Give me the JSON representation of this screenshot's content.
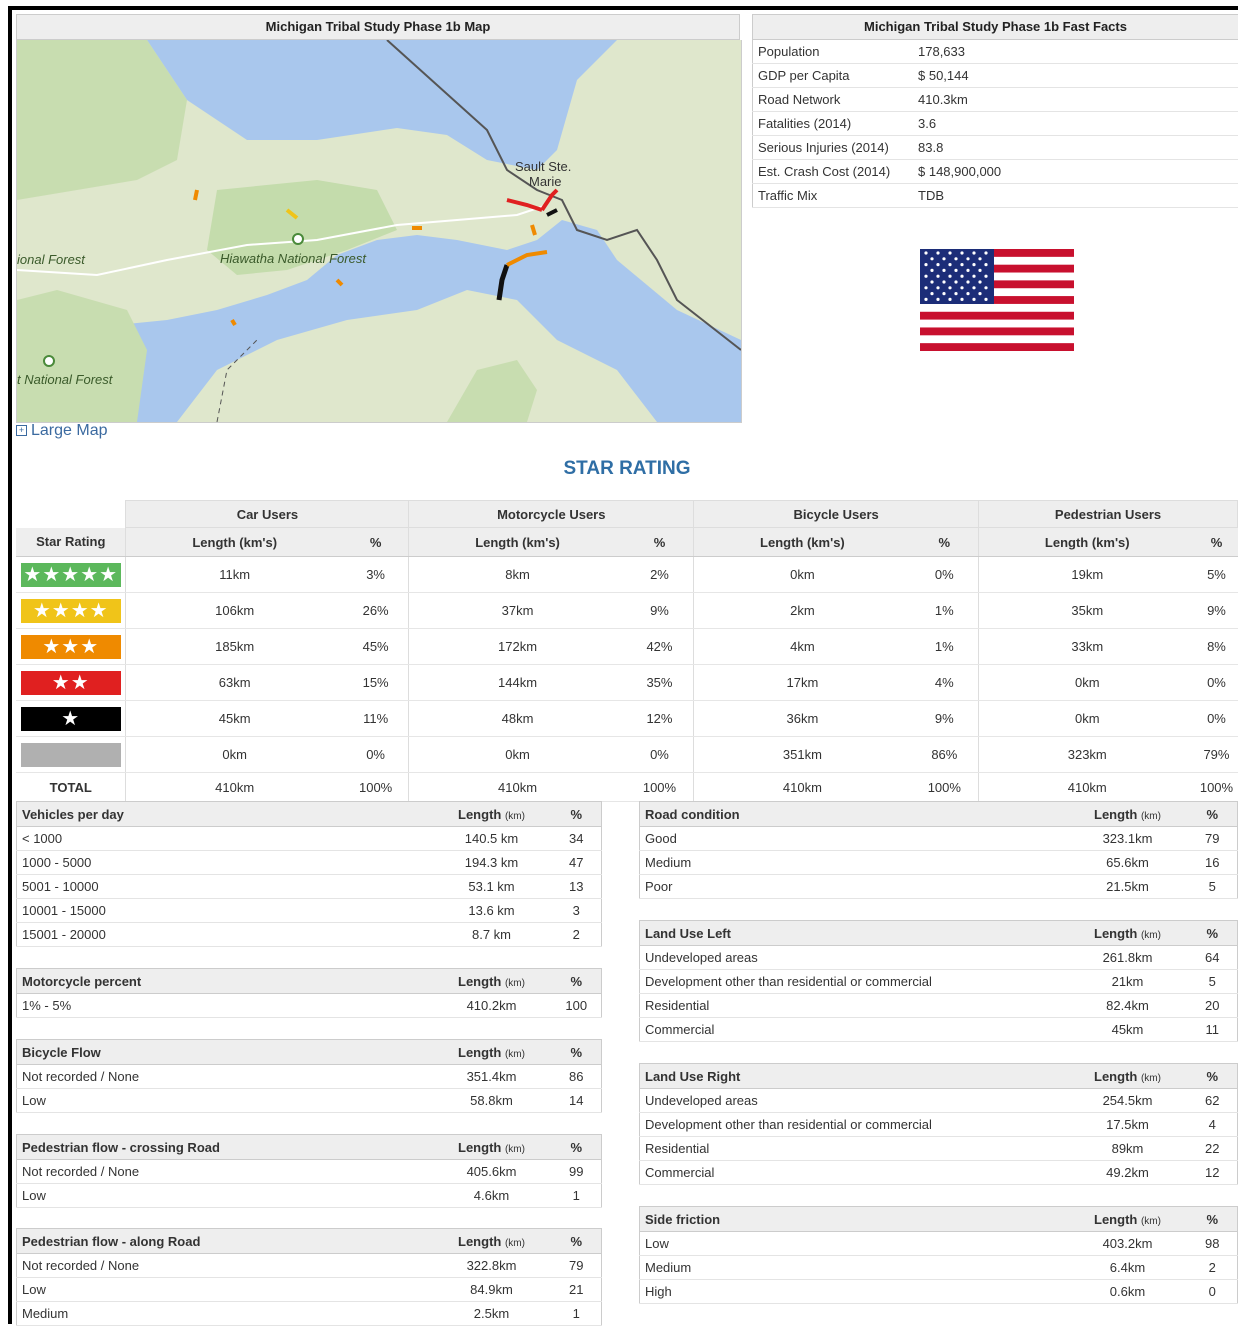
{
  "map": {
    "title": "Michigan Tribal Study Phase 1b Map",
    "labels": {
      "city": "Sault Ste.",
      "city2": "Marie",
      "forest_left": "ional Forest",
      "forest_hiawatha": "Hiawatha National Forest",
      "forest_bottom": "t National Forest"
    },
    "large_map_link": "Large Map"
  },
  "facts": {
    "title": "Michigan Tribal Study Phase 1b Fast Facts",
    "rows": [
      {
        "label": "Population",
        "value": "178,633"
      },
      {
        "label": "GDP per Capita",
        "value": "$ 50,144"
      },
      {
        "label": "Road Network",
        "value": "410.3km"
      },
      {
        "label": "Fatalities (2014)",
        "value": "3.6"
      },
      {
        "label": "Serious Injuries (2014)",
        "value": "83.8"
      },
      {
        "label": "Est. Crash Cost (2014)",
        "value": "$ 148,900,000"
      },
      {
        "label": "Traffic Mix",
        "value": "TDB"
      }
    ]
  },
  "star_rating": {
    "title": "STAR RATING",
    "groups": [
      "Car Users",
      "Motorcycle Users",
      "Bicycle Users",
      "Pedestrian Users"
    ],
    "col_star": "Star Rating",
    "col_length": "Length (km's)",
    "col_pct": "%",
    "total_label": "TOTAL",
    "rows": [
      {
        "stars": "★★★★★",
        "color": "#5cb85c",
        "vals": [
          "11km",
          "3%",
          "8km",
          "2%",
          "0km",
          "0%",
          "19km",
          "5%"
        ]
      },
      {
        "stars": "★★★★",
        "color": "#f0c419",
        "vals": [
          "106km",
          "26%",
          "37km",
          "9%",
          "2km",
          "1%",
          "35km",
          "9%"
        ]
      },
      {
        "stars": "★★★",
        "color": "#ef8a00",
        "vals": [
          "185km",
          "45%",
          "172km",
          "42%",
          "4km",
          "1%",
          "33km",
          "8%"
        ]
      },
      {
        "stars": "★★",
        "color": "#e02020",
        "vals": [
          "63km",
          "15%",
          "144km",
          "35%",
          "17km",
          "4%",
          "0km",
          "0%"
        ]
      },
      {
        "stars": "★",
        "color": "#000000",
        "vals": [
          "45km",
          "11%",
          "48km",
          "12%",
          "36km",
          "9%",
          "0km",
          "0%"
        ]
      },
      {
        "stars": "",
        "color": "#b0b0b0",
        "vals": [
          "0km",
          "0%",
          "0km",
          "0%",
          "351km",
          "86%",
          "323km",
          "79%"
        ]
      }
    ],
    "total": [
      "410km",
      "100%",
      "410km",
      "100%",
      "410km",
      "100%",
      "410km",
      "100%"
    ]
  },
  "length_header": "Length",
  "length_unit": "(km)",
  "pct_header": "%",
  "vehicles": {
    "title": "Vehicles per day",
    "rows": [
      {
        "label": "< 1000",
        "length": "140.5 km",
        "pct": "34"
      },
      {
        "label": "1000 - 5000",
        "length": "194.3 km",
        "pct": "47"
      },
      {
        "label": "5001 - 10000",
        "length": "53.1 km",
        "pct": "13"
      },
      {
        "label": "10001 - 15000",
        "length": "13.6 km",
        "pct": "3"
      },
      {
        "label": "15001 - 20000",
        "length": "8.7 km",
        "pct": "2"
      }
    ]
  },
  "motorcycle": {
    "title": "Motorcycle percent",
    "rows": [
      {
        "label": "1% - 5%",
        "length": "410.2km",
        "pct": "100"
      }
    ]
  },
  "bicycle": {
    "title": "Bicycle Flow",
    "rows": [
      {
        "label": "Not recorded / None",
        "length": "351.4km",
        "pct": "86"
      },
      {
        "label": "Low",
        "length": "58.8km",
        "pct": "14"
      }
    ]
  },
  "ped_cross": {
    "title": "Pedestrian flow - crossing Road",
    "rows": [
      {
        "label": "Not recorded / None",
        "length": "405.6km",
        "pct": "99"
      },
      {
        "label": "Low",
        "length": "4.6km",
        "pct": "1"
      }
    ]
  },
  "ped_along": {
    "title": "Pedestrian flow - along Road",
    "rows": [
      {
        "label": "Not recorded / None",
        "length": "322.8km",
        "pct": "79"
      },
      {
        "label": "Low",
        "length": "84.9km",
        "pct": "21"
      },
      {
        "label": "Medium",
        "length": "2.5km",
        "pct": "1"
      }
    ]
  },
  "road_cond": {
    "title": "Road condition",
    "rows": [
      {
        "label": "Good",
        "length": "323.1km",
        "pct": "79"
      },
      {
        "label": "Medium",
        "length": "65.6km",
        "pct": "16"
      },
      {
        "label": "Poor",
        "length": "21.5km",
        "pct": "5"
      }
    ]
  },
  "land_left": {
    "title": "Land Use Left",
    "rows": [
      {
        "label": "Undeveloped areas",
        "length": "261.8km",
        "pct": "64"
      },
      {
        "label": "Development other than residential or commercial",
        "length": "21km",
        "pct": "5"
      },
      {
        "label": "Residential",
        "length": "82.4km",
        "pct": "20"
      },
      {
        "label": "Commercial",
        "length": "45km",
        "pct": "11"
      }
    ]
  },
  "land_right": {
    "title": "Land Use Right",
    "rows": [
      {
        "label": "Undeveloped areas",
        "length": "254.5km",
        "pct": "62"
      },
      {
        "label": "Development other than residential or commercial",
        "length": "17.5km",
        "pct": "4"
      },
      {
        "label": "Residential",
        "length": "89km",
        "pct": "22"
      },
      {
        "label": "Commercial",
        "length": "49.2km",
        "pct": "12"
      }
    ]
  },
  "side_friction": {
    "title": "Side friction",
    "rows": [
      {
        "label": "Low",
        "length": "403.2km",
        "pct": "98"
      },
      {
        "label": "Medium",
        "length": "6.4km",
        "pct": "2"
      },
      {
        "label": "High",
        "length": "0.6km",
        "pct": "0"
      }
    ]
  }
}
